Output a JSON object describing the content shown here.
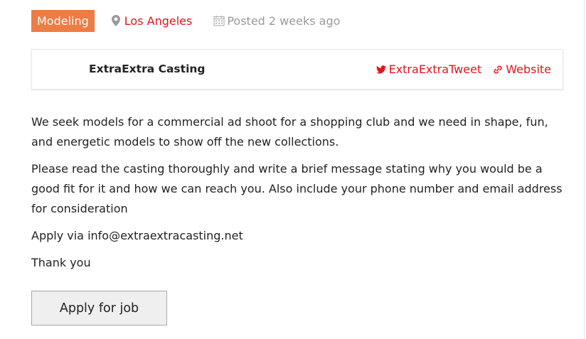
{
  "job": {
    "category": "Modeling",
    "location": "Los Angeles",
    "posted": "Posted 2 weeks ago"
  },
  "company": {
    "name": "ExtraExtra Casting",
    "twitter": "ExtraExtraTweet",
    "website": "Website"
  },
  "description": {
    "paragraphs": [
      "We seek models for a commercial ad shoot for a shopping club and we need in shape, fun, and energetic models to show off the new collections.",
      "Please read the casting thoroughly and write a brief message stating why you would be a good fit for it and how we can reach you. Also include your phone number and email address for consideration",
      "Apply via info@extraextracasting.net",
      "Thank you"
    ]
  },
  "apply_button": "Apply for job",
  "colors": {
    "accent_red": "#e3141c",
    "tag_orange": "#ed7c45",
    "muted_gray": "#9a9a9a"
  },
  "icons": {
    "location": "map-marker-icon",
    "posted": "calendar-icon",
    "twitter": "twitter-icon",
    "website": "link-icon"
  }
}
